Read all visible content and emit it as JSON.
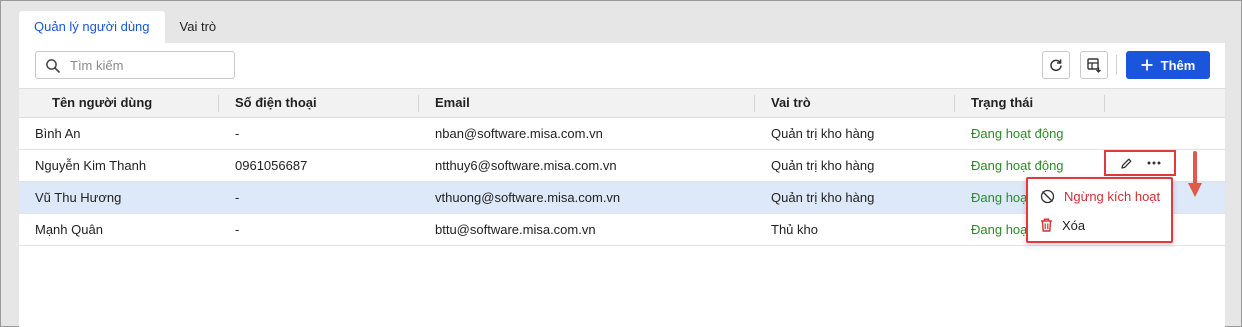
{
  "tabs": [
    {
      "label": "Quản lý người dùng"
    },
    {
      "label": "Vai trò"
    }
  ],
  "toolbar": {
    "search_placeholder": "Tìm kiếm",
    "add_label": "Thêm",
    "refresh_icon": "refresh-icon",
    "columns_icon": "table-settings-icon"
  },
  "table": {
    "headers": [
      "Tên người dùng",
      "Số điện thoại",
      "Email",
      "Vai trò",
      "Trạng thái"
    ],
    "rows": [
      {
        "name": "Bình An",
        "phone": "-",
        "email": "nban@software.misa.com.vn",
        "role": "Quản trị kho hàng",
        "status": "Đang hoạt động"
      },
      {
        "name": "Nguyễn Kim Thanh",
        "phone": "0961056687",
        "email": "ntthuy6@software.misa.com.vn",
        "role": "Quản trị kho hàng",
        "status": "Đang hoạt động"
      },
      {
        "name": "Vũ Thu Hương",
        "phone": "-",
        "email": "vthuong@software.misa.com.vn",
        "role": "Quản trị kho hàng",
        "status": "Đang hoạt động"
      },
      {
        "name": "Mạnh Quân",
        "phone": "-",
        "email": "bttu@software.misa.com.vn",
        "role": "Thủ kho",
        "status": "Đang hoạt động"
      }
    ]
  },
  "menu": {
    "deactivate_label": "Ngừng kích hoạt",
    "delete_label": "Xóa"
  },
  "colors": {
    "accent": "#1a56db",
    "status_active": "#2a8a2a",
    "highlight": "#e03a3a",
    "selected_row": "#dde8f8"
  }
}
